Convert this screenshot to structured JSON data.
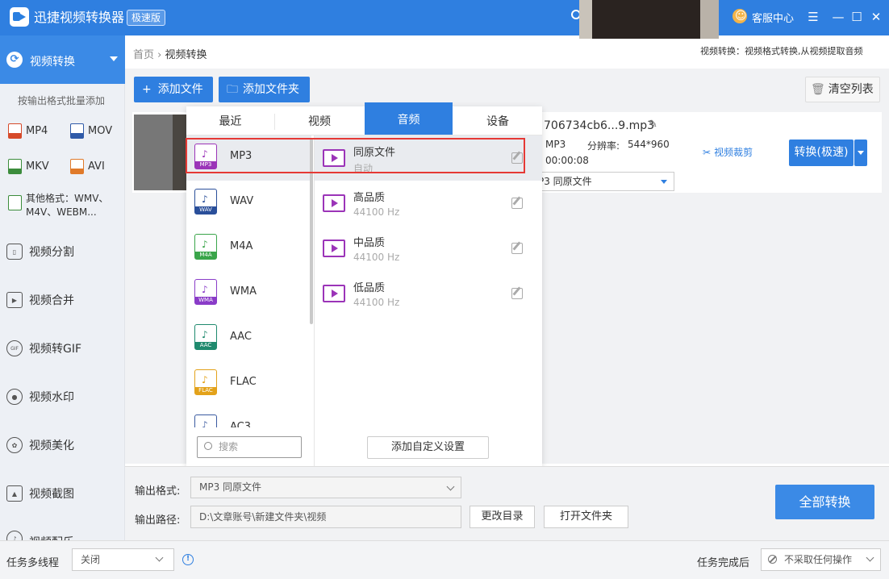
{
  "app": {
    "title": "迅捷视频转换器",
    "edition": "极速版",
    "service": "客服中心"
  },
  "window": {
    "minimize": "—",
    "maximize": "☐",
    "close": "✕",
    "menu": "☰"
  },
  "sidebar": {
    "active": "视频转换",
    "batch_label": "按输出格式批量添加",
    "formats": [
      {
        "label": "MP4",
        "color": "#d64a2a"
      },
      {
        "label": "MOV",
        "color": "#2f5aa8"
      },
      {
        "label": "MKV",
        "color": "#3c8c3c"
      },
      {
        "label": "AVI",
        "color": "#e07a2a"
      }
    ],
    "other_formats_line1": "其他格式：WMV、",
    "other_formats_line2": "M4V、WEBM...",
    "items": [
      {
        "label": "视频分割",
        "icon": "split-icon"
      },
      {
        "label": "视频合并",
        "icon": "merge-icon"
      },
      {
        "label": "视频转GIF",
        "icon": "gif-icon",
        "glyph": "GIF"
      },
      {
        "label": "视频水印",
        "icon": "watermark-icon"
      },
      {
        "label": "视频美化",
        "icon": "beautify-icon"
      },
      {
        "label": "视频截图",
        "icon": "screenshot-icon"
      },
      {
        "label": "视频配乐",
        "icon": "music-icon"
      }
    ]
  },
  "breadcrumb": {
    "home": "首页",
    "sep": "›",
    "current": "视频转换"
  },
  "header_desc": "视频转换：视频格式转换,从视频提取音频",
  "toolbar": {
    "add_file": "添加文件",
    "add_folder": "添加文件夹",
    "clear": "清空列表",
    "plus": "+",
    "folder_icon": "🗀",
    "trash_icon": "🗑"
  },
  "file": {
    "name": "706734cb6...9.mp3",
    "format": "MP3",
    "res_label": "分辨率:",
    "resolution": "544*960",
    "duration": "00:00:08",
    "select_value": "P3  同原文件",
    "crop": "视频裁剪",
    "convert": "转换(极速)"
  },
  "popup": {
    "tabs": [
      "最近",
      "视频",
      "音频",
      "设备"
    ],
    "active_tab": "音频",
    "formats": [
      {
        "label": "MP3",
        "tag": "MP3",
        "color": "#9b34b8"
      },
      {
        "label": "WAV",
        "tag": "WAV",
        "color": "#2a4f9a"
      },
      {
        "label": "M4A",
        "tag": "M4A",
        "color": "#3aa54a"
      },
      {
        "label": "WMA",
        "tag": "WMA",
        "color": "#8a3cc8"
      },
      {
        "label": "AAC",
        "tag": "AAC",
        "color": "#1f8a6e"
      },
      {
        "label": "FLAC",
        "tag": "FLAC",
        "color": "#e3a21a"
      },
      {
        "label": "AC3",
        "tag": "AC3",
        "color": "#3a5aa0"
      }
    ],
    "qualities": [
      {
        "title": "同原文件",
        "sub": "自动"
      },
      {
        "title": "高品质",
        "sub": "44100 Hz"
      },
      {
        "title": "中品质",
        "sub": "44100 Hz"
      },
      {
        "title": "低品质",
        "sub": "44100 Hz"
      }
    ],
    "search_placeholder": "搜索",
    "custom_btn": "添加自定义设置"
  },
  "output": {
    "format_label": "输出格式:",
    "format_value": "MP3  同原文件",
    "path_label": "输出路径:",
    "path_value": "D:\\文章账号\\新建文件夹\\视频",
    "change_dir": "更改目录",
    "open_folder": "打开文件夹",
    "convert_all": "全部转换"
  },
  "status": {
    "multi_label": "任务多线程",
    "multi_value": "关闭",
    "after_label": "任务完成后",
    "after_value": "不采取任何操作"
  }
}
